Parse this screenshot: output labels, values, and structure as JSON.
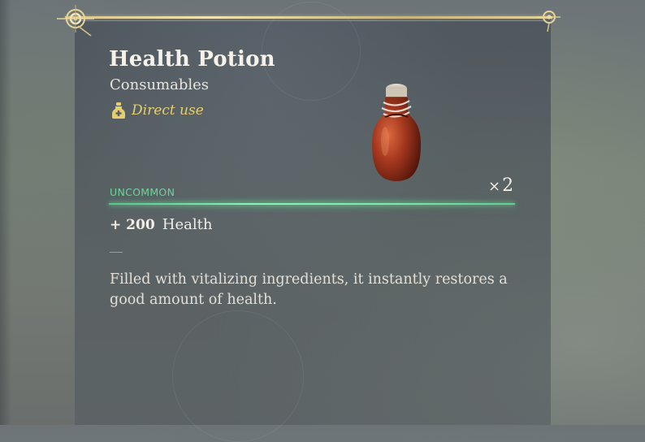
{
  "item": {
    "name": "Health Potion",
    "category": "Consumables",
    "use_type": "Direct use",
    "use_icon": "potion-bottle-icon",
    "rarity": "UNCOMMON",
    "rarity_color": "#6fd39b",
    "quantity_prefix": "×",
    "quantity": "2",
    "stat": {
      "value": "+ 200",
      "label": "Health"
    },
    "divider": "—",
    "description": "Filled with vitalizing ingredients, it instantly restores a good amount of health.",
    "image": "health-potion-bottle-icon"
  },
  "colors": {
    "title": "#f6f2ea",
    "use_type": "#e6cf6a",
    "frame_gold": "#d9c489",
    "rarity_bar": "#8ff0b8"
  }
}
